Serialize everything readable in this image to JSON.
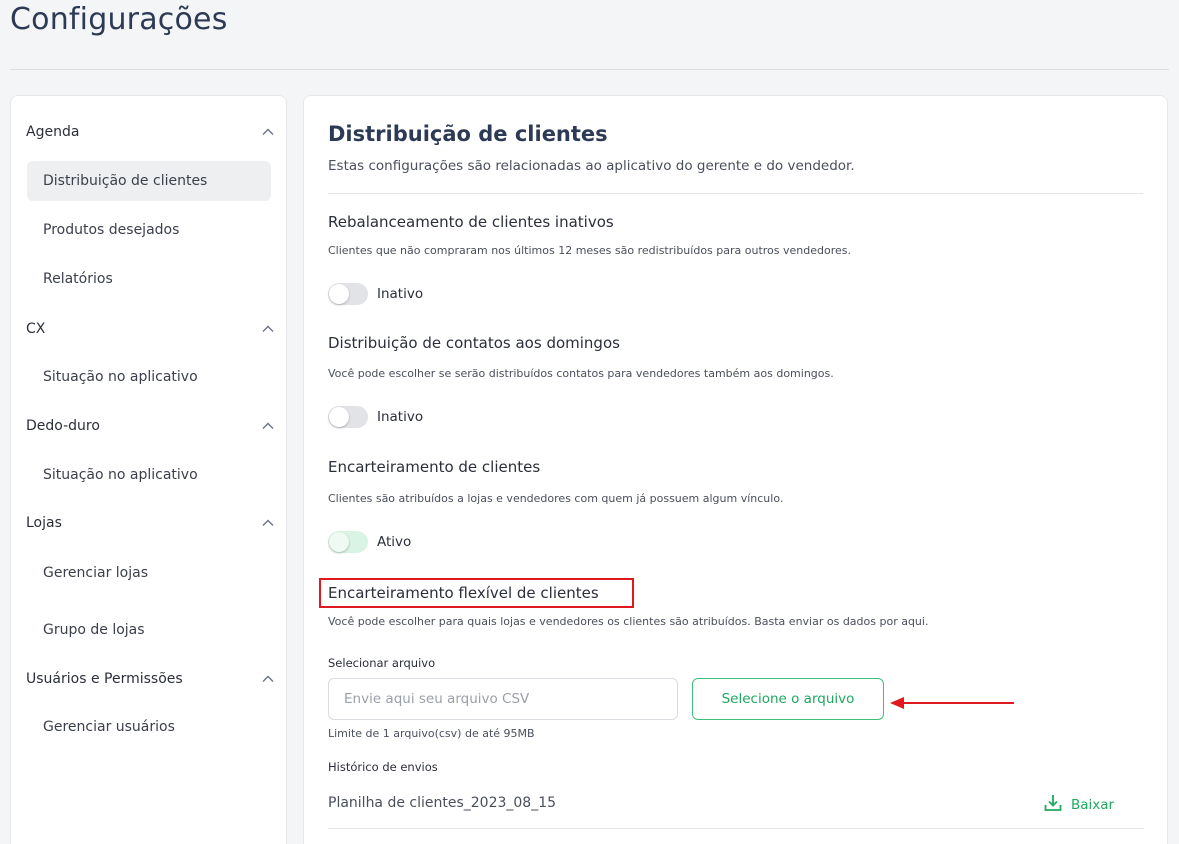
{
  "page": {
    "title": "Configurações"
  },
  "sidebar": {
    "groups": [
      {
        "label": "Agenda",
        "items": [
          "Distribuição de clientes",
          "Produtos desejados",
          "Relatórios"
        ]
      },
      {
        "label": "CX",
        "items": [
          "Situação no aplicativo"
        ]
      },
      {
        "label": "Dedo-duro",
        "items": [
          "Situação no aplicativo"
        ]
      },
      {
        "label": "Lojas",
        "items": [
          "Gerenciar lojas",
          "Grupo de lojas"
        ]
      },
      {
        "label": "Usuários e Permissões",
        "items": [
          "Gerenciar usuários"
        ]
      }
    ],
    "active_item": "Distribuição de clientes"
  },
  "main": {
    "title": "Distribuição de clientes",
    "description": "Estas configurações são relacionadas ao aplicativo do gerente e do vendedor.",
    "settings": [
      {
        "title": "Rebalanceamento de clientes inativos",
        "description": "Clientes que não compraram nos últimos 12 meses são redistribuídos para outros vendedores.",
        "toggle_label": "Inativo",
        "enabled": false
      },
      {
        "title": "Distribuição de contatos aos domingos",
        "description": "Você pode escolher se serão distribuídos contatos para vendedores também aos domingos.",
        "toggle_label": "Inativo",
        "enabled": false
      },
      {
        "title": "Encarteiramento de clientes",
        "description": "Clientes são atribuídos a lojas e vendedores com quem já possuem algum vínculo.",
        "toggle_label": "Ativo",
        "enabled": true
      }
    ],
    "flex": {
      "title": "Encarteiramento flexível de clientes",
      "description": "Você pode escolher para quais lojas e vendedores os clientes são atribuídos. Basta enviar os dados por aqui.",
      "file_label": "Selecionar arquivo",
      "file_placeholder": "Envie aqui seu arquivo CSV",
      "select_button": "Selecione o arquivo",
      "limit_text": "Limite de 1 arquivo(csv) de até 95MB",
      "history_label": "Histórico de envios",
      "history": [
        {
          "name": "Planilha de clientes_2023_08_15",
          "action": "Baixar"
        }
      ]
    }
  },
  "colors": {
    "title": "#2c3a55",
    "accent_green": "#1fa85f",
    "highlight_red": "#e0191f",
    "active_item_bg": "#eeeff1"
  },
  "icons": {
    "chevron": "chevron-up-icon",
    "download": "download-icon",
    "annotation": "red-arrow-icon"
  }
}
